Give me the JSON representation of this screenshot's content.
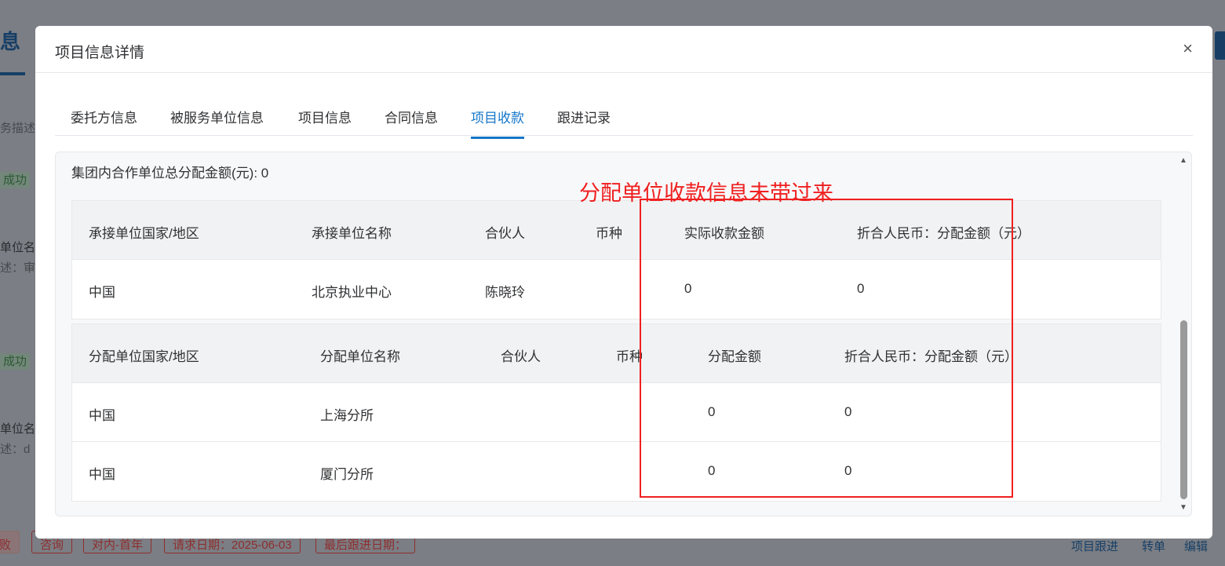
{
  "background": {
    "title_fragment": "息",
    "desc_fragment": "务描述",
    "status1": "成功",
    "unit1": "单位名",
    "desc1": "述：审",
    "status2": "成功",
    "unit2": "单位名",
    "desc2": "述：d",
    "tags": [
      "败",
      "咨询",
      "对内-首年",
      "请求日期：2025-06-03",
      "最后跟进日期："
    ],
    "actions": [
      "项目跟进",
      "转单",
      "编辑"
    ]
  },
  "modal": {
    "title": "项目信息详情",
    "close": "×",
    "tabs": [
      "委托方信息",
      "被服务单位信息",
      "项目信息",
      "合同信息",
      "项目收款",
      "跟进记录"
    ],
    "active_tab": "项目收款",
    "total_label": "集团内合作单位总分配金额(元): 0",
    "table1": {
      "headers": [
        "承接单位国家/地区",
        "承接单位名称",
        "合伙人",
        "币种",
        "实际收款金额",
        "折合人民币：分配金额（元）"
      ],
      "rows": [
        [
          "中国",
          "北京执业中心",
          "陈晓玲",
          "",
          "0",
          "0"
        ]
      ]
    },
    "table2": {
      "headers": [
        "分配单位国家/地区",
        "分配单位名称",
        "合伙人",
        "币种",
        "分配金额",
        "折合人民币：分配金额（元）"
      ],
      "rows": [
        [
          "中国",
          "上海分所",
          "",
          "",
          "0",
          "0"
        ],
        [
          "中国",
          "厦门分所",
          "",
          "",
          "0",
          "0"
        ]
      ]
    }
  },
  "annotation": {
    "text": "分配单位收款信息未带过来",
    "color": "#f02020"
  }
}
